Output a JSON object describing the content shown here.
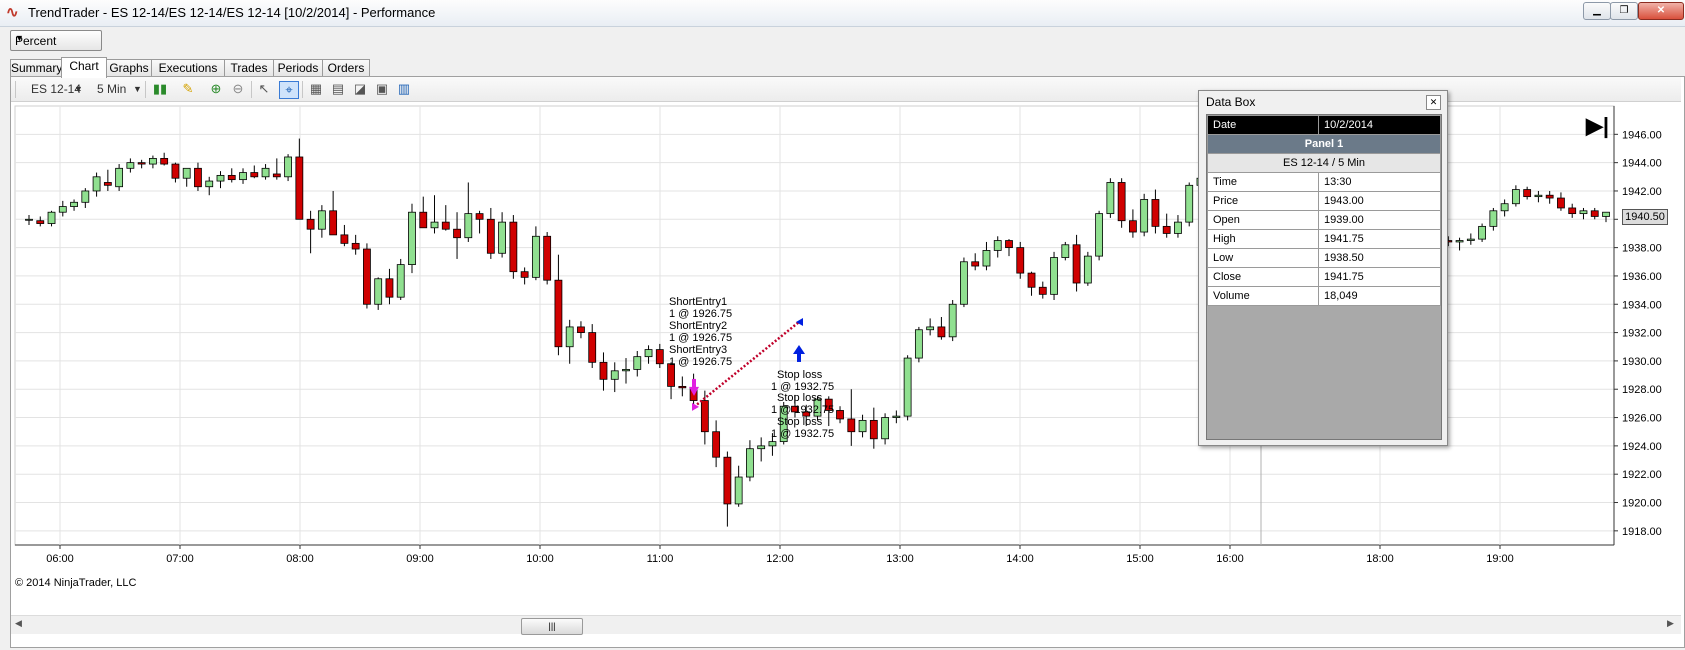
{
  "window": {
    "title": "TrendTrader - ES 12-14/ES 12-14/ES 12-14 [10/2/2014] - Performance",
    "app_icon": "trend-wave-icon"
  },
  "display_mode": {
    "selected": "Percent"
  },
  "tabs": [
    "Summary",
    "Chart",
    "Graphs",
    "Executions",
    "Trades",
    "Periods",
    "Orders"
  ],
  "active_tab": "Chart",
  "toolbar": {
    "instrument": "ES 12-14",
    "interval": "5 Min",
    "icons": [
      "bar-type-icon",
      "pencil-icon",
      "zoom-in-icon",
      "zoom-out-icon",
      "cursor-icon",
      "snapshot-icon",
      "properties-icon",
      "indicators-icon",
      "strategies-icon",
      "data-box-icon"
    ]
  },
  "databox": {
    "title": "Data Box",
    "date_label": "Date",
    "date_value": "10/2/2014",
    "panel": "Panel 1",
    "instrument": "ES 12-14 / 5 Min",
    "rows": [
      {
        "label": "Time",
        "value": "13:30"
      },
      {
        "label": "Price",
        "value": "1943.00"
      },
      {
        "label": "Open",
        "value": "1939.00"
      },
      {
        "label": "High",
        "value": "1941.75"
      },
      {
        "label": "Low",
        "value": "1938.50"
      },
      {
        "label": "Close",
        "value": "1941.75"
      },
      {
        "label": "Volume",
        "value": "18,049"
      }
    ]
  },
  "copyright": "© 2014 NinjaTrader, LLC",
  "chart_data": {
    "type": "candlestick",
    "ylim": [
      1917,
      1948
    ],
    "y_ticks": [
      "1946.00",
      "1944.00",
      "1942.00",
      "1940.00",
      "1938.00",
      "1936.00",
      "1934.00",
      "1932.00",
      "1930.00",
      "1928.00",
      "1926.00",
      "1924.00",
      "1922.00",
      "1920.00",
      "1918.00"
    ],
    "x_ticks": [
      "06:00",
      "07:00",
      "08:00",
      "09:00",
      "10:00",
      "11:00",
      "12:00",
      "13:00",
      "14:00",
      "15:00",
      "16:00",
      "18:00",
      "19:00"
    ],
    "current_price": "1940.50",
    "up_color": "#90e090",
    "down_color": "#d00000",
    "grid": true,
    "annotations": [
      {
        "text": "ShortEntry1",
        "time": "11:10"
      },
      {
        "text": "1 @ 1926.75",
        "time": "11:10"
      },
      {
        "text": "ShortEntry2",
        "time": "11:10"
      },
      {
        "text": "1 @ 1926.75",
        "time": "11:10"
      },
      {
        "text": "ShortEntry3",
        "time": "11:10"
      },
      {
        "text": "1 @ 1926.75",
        "time": "11:10"
      },
      {
        "text": "Stop loss",
        "time": "12:05"
      },
      {
        "text": "1 @ 1932.75",
        "time": "12:05"
      },
      {
        "text": "Stop loss",
        "time": "12:05"
      },
      {
        "text": "1 @ 1932.75",
        "time": "12:05"
      },
      {
        "text": "Stop loss",
        "time": "12:05"
      },
      {
        "text": "1 @ 1932.75",
        "time": "12:05"
      }
    ],
    "trade": {
      "entry_time": "11:15",
      "entry_price": 1926.75,
      "exit_time": "12:05",
      "exit_price": 1932.75
    },
    "candles": [
      [
        1940.0,
        1940.3,
        1939.6,
        1940.0
      ],
      [
        1939.9,
        1940.2,
        1939.5,
        1939.7
      ],
      [
        1939.7,
        1940.6,
        1939.5,
        1940.5
      ],
      [
        1940.5,
        1941.3,
        1940.2,
        1940.9
      ],
      [
        1940.9,
        1941.4,
        1940.6,
        1941.2
      ],
      [
        1941.2,
        1942.2,
        1940.8,
        1942.0
      ],
      [
        1942.0,
        1943.3,
        1941.6,
        1943.0
      ],
      [
        1942.6,
        1943.5,
        1942.0,
        1942.4
      ],
      [
        1942.3,
        1943.9,
        1942.0,
        1943.6
      ],
      [
        1943.6,
        1944.3,
        1943.3,
        1944.0
      ],
      [
        1944.0,
        1944.2,
        1943.6,
        1943.9
      ],
      [
        1943.9,
        1944.5,
        1943.6,
        1944.3
      ],
      [
        1944.3,
        1944.7,
        1943.8,
        1943.9
      ],
      [
        1943.9,
        1944.0,
        1942.6,
        1942.9
      ],
      [
        1942.9,
        1943.6,
        1942.3,
        1943.6
      ],
      [
        1943.6,
        1944.0,
        1942.0,
        1942.3
      ],
      [
        1942.3,
        1943.0,
        1941.7,
        1942.7
      ],
      [
        1942.7,
        1943.4,
        1942.2,
        1943.1
      ],
      [
        1943.1,
        1943.6,
        1942.6,
        1942.8
      ],
      [
        1942.8,
        1943.6,
        1942.5,
        1943.3
      ],
      [
        1943.3,
        1943.8,
        1942.9,
        1943.0
      ],
      [
        1943.0,
        1943.9,
        1942.8,
        1943.6
      ],
      [
        1943.2,
        1944.3,
        1942.8,
        1943.0
      ],
      [
        1943.0,
        1944.6,
        1942.7,
        1944.4
      ],
      [
        1944.4,
        1945.7,
        1943.8,
        1940.0
      ],
      [
        1940.0,
        1940.6,
        1937.6,
        1939.3
      ],
      [
        1939.3,
        1941.0,
        1938.7,
        1940.6
      ],
      [
        1940.6,
        1942.0,
        1939.7,
        1938.9
      ],
      [
        1938.9,
        1939.6,
        1938.1,
        1938.3
      ],
      [
        1938.3,
        1938.9,
        1937.5,
        1937.9
      ],
      [
        1937.9,
        1938.3,
        1933.7,
        1934.0
      ],
      [
        1934.0,
        1935.9,
        1933.6,
        1935.8
      ],
      [
        1935.8,
        1936.5,
        1934.0,
        1934.5
      ],
      [
        1934.5,
        1937.2,
        1934.3,
        1936.8
      ],
      [
        1936.8,
        1941.1,
        1936.2,
        1940.5
      ],
      [
        1940.5,
        1941.6,
        1939.6,
        1939.4
      ],
      [
        1939.4,
        1941.7,
        1939.0,
        1939.8
      ],
      [
        1939.8,
        1941.0,
        1939.2,
        1939.3
      ],
      [
        1939.3,
        1940.5,
        1937.2,
        1938.7
      ],
      [
        1938.7,
        1942.6,
        1938.4,
        1940.4
      ],
      [
        1940.4,
        1940.6,
        1939.0,
        1940.0
      ],
      [
        1940.0,
        1940.8,
        1937.2,
        1937.6
      ],
      [
        1937.6,
        1940.5,
        1937.3,
        1939.8
      ],
      [
        1939.8,
        1940.3,
        1935.8,
        1936.3
      ],
      [
        1936.3,
        1936.6,
        1935.4,
        1935.9
      ],
      [
        1935.9,
        1939.5,
        1935.7,
        1938.8
      ],
      [
        1938.8,
        1939.1,
        1935.4,
        1935.7
      ],
      [
        1935.7,
        1937.5,
        1930.4,
        1931.0
      ],
      [
        1931.0,
        1932.9,
        1929.8,
        1932.4
      ],
      [
        1932.4,
        1932.8,
        1931.6,
        1932.0
      ],
      [
        1932.0,
        1932.6,
        1929.5,
        1929.9
      ],
      [
        1929.9,
        1930.6,
        1927.9,
        1928.7
      ],
      [
        1928.7,
        1929.9,
        1927.8,
        1929.3
      ],
      [
        1929.3,
        1930.2,
        1928.4,
        1929.4
      ],
      [
        1929.4,
        1930.7,
        1928.9,
        1930.3
      ],
      [
        1930.3,
        1931.1,
        1929.8,
        1930.8
      ],
      [
        1930.8,
        1931.2,
        1929.5,
        1929.8
      ],
      [
        1929.8,
        1929.9,
        1927.3,
        1928.2
      ],
      [
        1928.2,
        1928.9,
        1927.5,
        1928.1
      ],
      [
        1928.1,
        1929.1,
        1926.7,
        1927.2
      ],
      [
        1927.2,
        1927.9,
        1924.1,
        1925.0
      ],
      [
        1925.0,
        1925.8,
        1922.5,
        1923.2
      ],
      [
        1923.2,
        1923.6,
        1918.3,
        1919.9
      ],
      [
        1919.9,
        1922.6,
        1919.7,
        1921.8
      ],
      [
        1921.8,
        1924.4,
        1921.5,
        1923.8
      ],
      [
        1923.8,
        1924.6,
        1922.9,
        1924.0
      ],
      [
        1924.0,
        1924.9,
        1923.3,
        1924.3
      ],
      [
        1924.3,
        1927.1,
        1924.1,
        1926.8
      ],
      [
        1926.8,
        1927.6,
        1926.0,
        1926.4
      ],
      [
        1926.4,
        1926.9,
        1925.4,
        1926.1
      ],
      [
        1926.1,
        1927.5,
        1925.8,
        1927.3
      ],
      [
        1927.3,
        1927.5,
        1925.4,
        1926.5
      ],
      [
        1926.5,
        1926.8,
        1925.6,
        1925.9
      ],
      [
        1925.9,
        1928.0,
        1924.0,
        1925.0
      ],
      [
        1925.0,
        1926.2,
        1924.6,
        1925.8
      ],
      [
        1925.8,
        1926.7,
        1923.8,
        1924.5
      ],
      [
        1924.5,
        1926.3,
        1924.1,
        1926.0
      ],
      [
        1926.0,
        1926.5,
        1925.6,
        1926.1
      ],
      [
        1926.1,
        1930.4,
        1925.8,
        1930.2
      ],
      [
        1930.2,
        1932.4,
        1929.9,
        1932.2
      ],
      [
        1932.2,
        1933.0,
        1931.8,
        1932.4
      ],
      [
        1932.4,
        1933.1,
        1931.5,
        1931.7
      ],
      [
        1931.7,
        1934.3,
        1931.4,
        1934.0
      ],
      [
        1934.0,
        1937.3,
        1933.8,
        1937.0
      ],
      [
        1937.0,
        1937.6,
        1936.4,
        1936.7
      ],
      [
        1936.7,
        1938.4,
        1936.4,
        1937.8
      ],
      [
        1937.8,
        1938.8,
        1937.3,
        1938.5
      ],
      [
        1938.5,
        1938.6,
        1937.4,
        1938.0
      ],
      [
        1938.0,
        1938.4,
        1935.8,
        1936.2
      ],
      [
        1936.2,
        1936.3,
        1934.6,
        1935.2
      ],
      [
        1935.2,
        1935.6,
        1934.4,
        1934.7
      ],
      [
        1934.7,
        1937.7,
        1934.3,
        1937.3
      ],
      [
        1937.3,
        1938.4,
        1937.1,
        1938.2
      ],
      [
        1938.2,
        1938.9,
        1934.9,
        1935.5
      ],
      [
        1935.5,
        1937.7,
        1935.3,
        1937.4
      ],
      [
        1937.4,
        1940.6,
        1937.1,
        1940.4
      ],
      [
        1940.4,
        1942.9,
        1940.1,
        1942.6
      ],
      [
        1942.6,
        1942.9,
        1939.4,
        1939.9
      ],
      [
        1939.9,
        1940.7,
        1938.7,
        1939.1
      ],
      [
        1939.1,
        1941.8,
        1938.8,
        1941.4
      ],
      [
        1941.4,
        1942.1,
        1939.0,
        1939.5
      ],
      [
        1939.5,
        1940.4,
        1938.7,
        1939.0
      ],
      [
        1939.0,
        1940.3,
        1938.7,
        1939.8
      ],
      [
        1939.8,
        1942.6,
        1939.5,
        1942.4
      ],
      [
        1942.4,
        1943.3,
        1941.8,
        1942.9
      ],
      [
        1942.9,
        1945.2,
        1942.5,
        1944.6
      ],
      [
        1944.6,
        1945.6,
        1943.9,
        1944.2
      ],
      [
        1944.2,
        1944.5,
        1942.5,
        1942.9
      ],
      [
        1942.9,
        1943.3,
        1941.5,
        1942.1
      ],
      [
        1942.1,
        1942.7,
        1940.9,
        1942.3
      ],
      [
        1942.3,
        1943.1,
        1941.3,
        1941.6
      ],
      [
        1941.6,
        1942.2,
        1938.3,
        1938.6
      ],
      [
        1938.6,
        1939.8,
        1938.4,
        1939.5
      ],
      [
        1939.5,
        1940.2,
        1938.5,
        1939.1
      ],
      [
        1939.1,
        1939.5,
        1937.7,
        1938.7
      ],
      [
        1938.7,
        1940.2,
        1938.3,
        1939.8
      ],
      [
        1939.8,
        1940.1,
        1938.0,
        1938.4
      ],
      [
        1938.4,
        1940.4,
        1937.9,
        1940.0
      ],
      [
        1940.0,
        1940.3,
        1937.6,
        1938.9
      ],
      [
        1938.9,
        1940.2,
        1938.6,
        1939.7
      ],
      [
        1939.7,
        1940.1,
        1938.4,
        1938.6
      ],
      [
        1938.6,
        1939.9,
        1938.3,
        1939.5
      ],
      [
        1939.5,
        1939.7,
        1938.0,
        1938.6
      ],
      [
        1938.6,
        1939.0,
        1938.0,
        1938.3
      ],
      [
        1938.3,
        1939.6,
        1938.1,
        1939.4
      ],
      [
        1938.4,
        1938.7,
        1938.0,
        1938.5
      ],
      [
        1938.5,
        1938.8,
        1938.1,
        1938.4
      ],
      [
        1938.4,
        1938.7,
        1937.8,
        1938.5
      ],
      [
        1938.5,
        1939.0,
        1938.2,
        1938.6
      ],
      [
        1938.6,
        1939.7,
        1938.4,
        1939.5
      ],
      [
        1939.5,
        1940.8,
        1939.2,
        1940.6
      ],
      [
        1940.6,
        1941.4,
        1940.2,
        1941.1
      ],
      [
        1941.1,
        1942.4,
        1940.9,
        1942.1
      ],
      [
        1942.1,
        1942.3,
        1941.4,
        1941.6
      ],
      [
        1941.6,
        1942.0,
        1941.2,
        1941.7
      ],
      [
        1941.7,
        1942.0,
        1941.1,
        1941.5
      ],
      [
        1941.5,
        1941.9,
        1940.6,
        1940.8
      ],
      [
        1940.8,
        1941.1,
        1940.1,
        1940.4
      ],
      [
        1940.4,
        1940.8,
        1940.0,
        1940.6
      ],
      [
        1940.6,
        1940.8,
        1940.0,
        1940.2
      ],
      [
        1940.2,
        1940.5,
        1939.8,
        1940.5
      ]
    ]
  }
}
